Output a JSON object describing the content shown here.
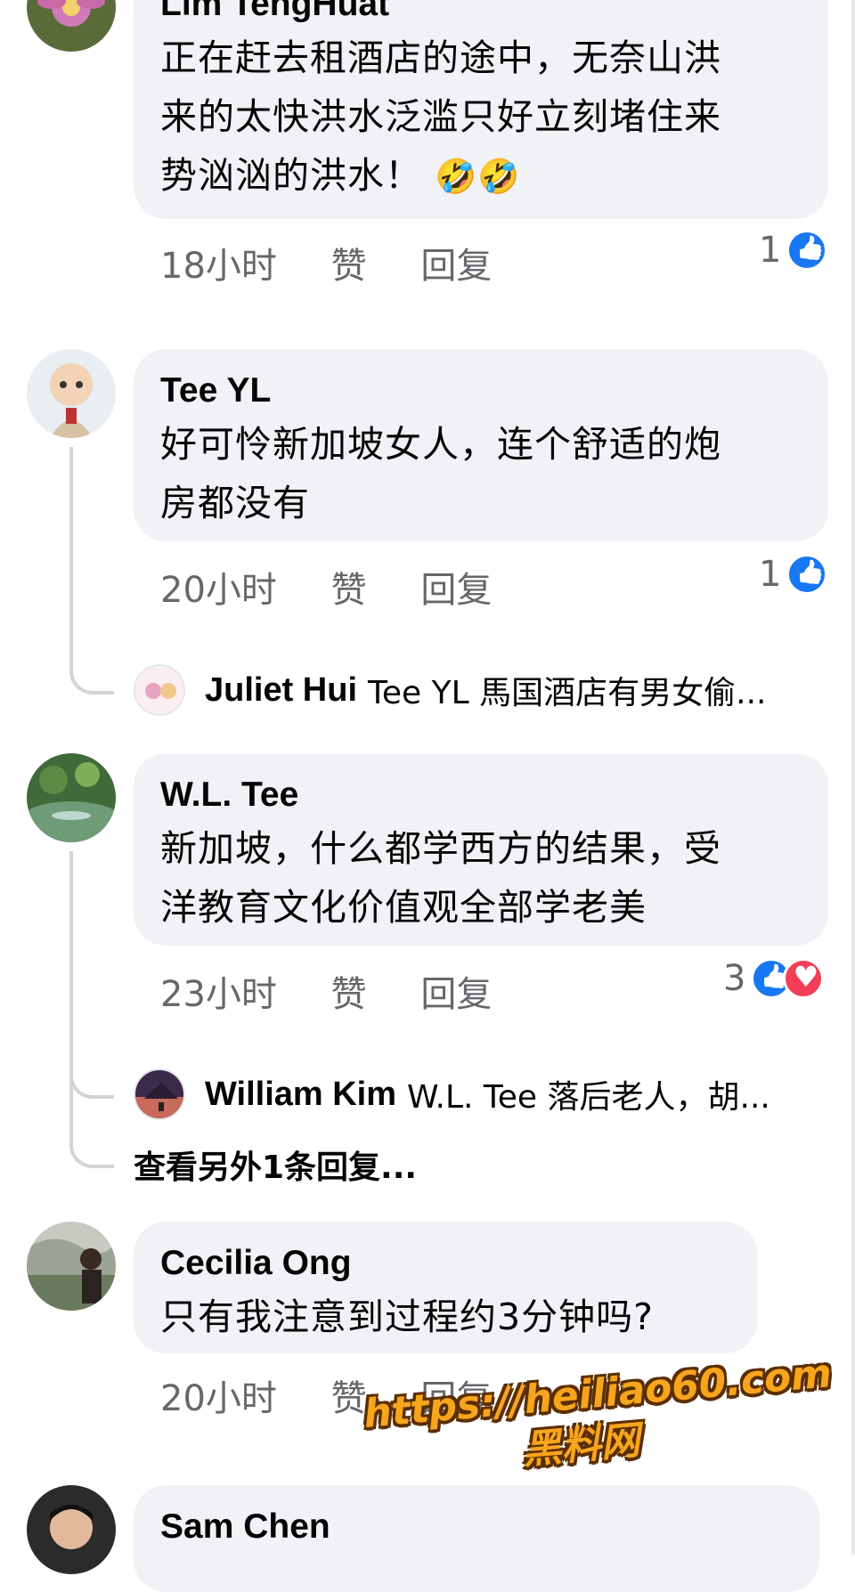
{
  "comments": [
    {
      "author": "Lim TengHuat",
      "text_line1": "正在赶去租酒店的途中，无奈山洪",
      "text_line2": "来的太快洪水泛滥只好立刻堵住来",
      "text_line3": "势汹汹的洪水！",
      "emoji": "🤣🤣",
      "time": "18小时",
      "like_label": "赞",
      "reply_label": "回复",
      "reaction_count": "1"
    },
    {
      "author": "Tee YL",
      "text_line1": "好可怜新加坡女人，连个舒适的炮",
      "text_line2": "房都没有",
      "time": "20小时",
      "like_label": "赞",
      "reply_label": "回复",
      "reaction_count": "1",
      "reply_preview": {
        "name": "Juliet Hui",
        "text": "Tee YL 馬国酒店有男女偷..."
      }
    },
    {
      "author": "W.L. Tee",
      "text_line1": "新加坡，什么都学西方的结果，受",
      "text_line2": "洋教育文化价值观全部学老美",
      "time": "23小时",
      "like_label": "赞",
      "reply_label": "回复",
      "reaction_count": "3",
      "reply_preview": {
        "name": "William Kim",
        "text": "W.L. Tee 落后老人，胡..."
      },
      "more_replies": "查看另外1条回复..."
    },
    {
      "author": "Cecilia Ong",
      "text_line1": "只有我注意到过程约3分钟吗?",
      "time": "20小时",
      "like_label": "赞",
      "reply_label": "回复"
    },
    {
      "author": "Sam Chen"
    }
  ],
  "watermark": {
    "url": "https://heiliao60.com",
    "name": "黑料网"
  },
  "colors": {
    "bubble": "#f0f2f5",
    "meta_text": "#65676b",
    "like_blue": "#1877f2",
    "heart_red": "#f33e58",
    "watermark_orange": "#f7a51c"
  }
}
